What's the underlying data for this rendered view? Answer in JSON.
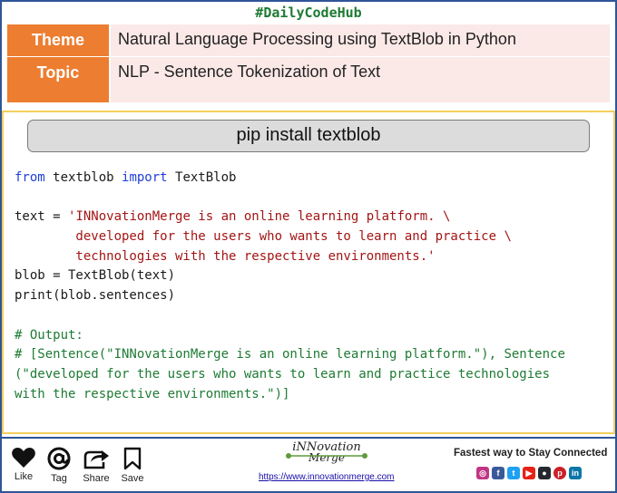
{
  "header": {
    "hashtag": "#DailyCodeHub"
  },
  "info": {
    "theme_label": "Theme",
    "theme_value": "Natural Language Processing  using TextBlob in Python",
    "topic_label": "Topic",
    "topic_value": "NLP - Sentence Tokenization  of Text"
  },
  "colors": {
    "label_bg": "#ed7d31",
    "value_bg": "#fbe9e7",
    "keyword": "#1f3fd6",
    "string": "#a31515",
    "comment": "#1e7b34",
    "frame": "#2e5597",
    "code_border": "#f2cf5b"
  },
  "code": {
    "command": "pip install textblob",
    "l1_kw1": "from",
    "l1_mid": " textblob ",
    "l1_kw2": "import",
    "l1_end": " TextBlob",
    "l3_pre": "text = ",
    "l3_str": "'INNovationMerge is an online learning platform. \\",
    "l4_str": "        developed for the users who wants to learn and practice \\",
    "l5_str": "        technologies with the respective environments.'",
    "l6": "blob = TextBlob(text)",
    "l7": "print(blob.sentences)",
    "c1": "# Output:",
    "c2": "# [Sentence(\"INNovationMerge is an online learning platform.\"), Sentence",
    "c3": "(\"developed for the users who wants to learn and practice technologies",
    "c4": "with the respective environments.\")]"
  },
  "footer": {
    "like": "Like",
    "tag": "Tag",
    "share": "Share",
    "save": "Save",
    "brand_name": "iNNovation",
    "brand_sub": "Merge",
    "url": "https://www.innovationmerge.com",
    "tagline": "Fastest way to Stay Connected",
    "socials": [
      "instagram-icon",
      "facebook-icon",
      "twitter-icon",
      "youtube-icon",
      "github-icon",
      "pinterest-icon",
      "linkedin-icon"
    ]
  }
}
